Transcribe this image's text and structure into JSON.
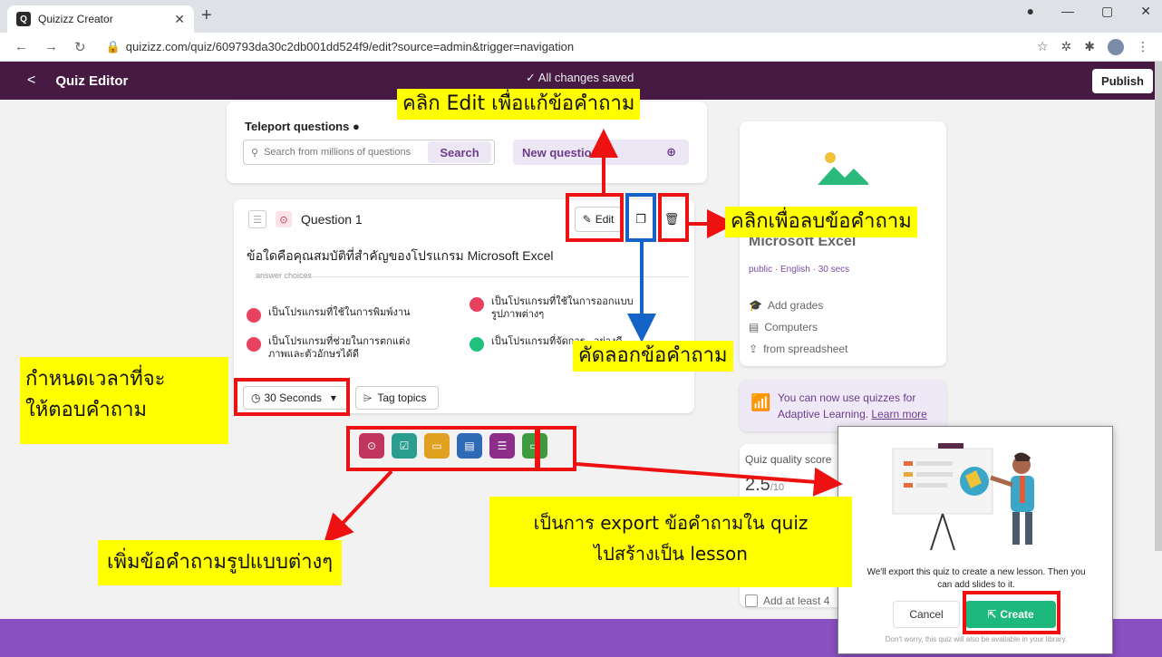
{
  "browser": {
    "tab_title": "Quizizz Creator",
    "tab_favicon": "Q",
    "url": "quizizz.com/quiz/609793da30c2db001dd524f9/edit?source=admin&trigger=navigation"
  },
  "app": {
    "back_icon": "<",
    "title": "Quiz Editor",
    "saved_status": "✓ All changes saved",
    "publish_label": "Publish"
  },
  "teleport": {
    "heading": "Teleport questions",
    "search_placeholder": "Search from millions of questions",
    "search_label": "Search",
    "new_question_label": "New question"
  },
  "question": {
    "label": "Question 1",
    "edit_label": "Edit",
    "text": "ข้อใดคือคุณสมบัติที่สำคัญของโปรแกรม Microsoft Excel",
    "answer_choices_label": "answer choices",
    "choices": [
      {
        "text": "เป็นโปรแกรมที่ใช้ในการพิมพ์งาน",
        "color": "#e8415f"
      },
      {
        "text": "เป็นโปรแกรมที่ใช้ในการออกแบบรูปภาพต่างๆ",
        "color": "#e8415f"
      },
      {
        "text": "เป็นโปรแกรมที่ช่วยในการตกแต่งภาพและตัวอักษรได้ดี",
        "color": "#e8415f"
      },
      {
        "text": "เป็นโปรแกรมที่จัดการ...อย่างดี",
        "color": "#1fc27d"
      }
    ],
    "time_label": "30 Seconds",
    "tag_label": "Tag topics"
  },
  "question_types": [
    {
      "name": "multiple-choice",
      "color": "#c0365c",
      "glyph": "⊙"
    },
    {
      "name": "checkbox",
      "color": "#2a9d8f",
      "glyph": "☑"
    },
    {
      "name": "fill-blank",
      "color": "#e0a020",
      "glyph": "▭"
    },
    {
      "name": "poll",
      "color": "#2f6ab7",
      "glyph": "▤"
    },
    {
      "name": "open-ended",
      "color": "#8c2d8a",
      "glyph": "☰"
    },
    {
      "name": "slide",
      "color": "#3d9a3f",
      "glyph": "▭"
    }
  ],
  "right_panel": {
    "quiz_name": "Microsoft Excel",
    "meta": "public · English · 30 secs",
    "add_grades": "Add grades",
    "subject": "Computers",
    "import": "from spreadsheet",
    "adaptive_text": "You can now use quizzes for Adaptive Learning.",
    "adaptive_link": "Learn more",
    "quality_label": "Quiz quality score",
    "quality_score": "2.5",
    "quality_out_of": "/10",
    "add_at_least": "Add at least 4"
  },
  "dialog": {
    "message": "We'll export this quiz to create a new lesson. Then you can add slides to it.",
    "cancel_label": "Cancel",
    "create_label": "Create",
    "footnote": "Don't worry, this quiz will also be available in your library."
  },
  "annotations": {
    "edit_note": "คลิก Edit เพื่อแก้ข้อคำถาม",
    "delete_note": "คลิกเพื่อลบข้อคำถาม",
    "copy_note": "คัดลอกข้อคำถาม",
    "time_note_1": "กำหนดเวลาที่จะ",
    "time_note_2": "ให้ตอบคำถาม",
    "types_note": "เพิ่มข้อคำถามรูปแบบต่างๆ",
    "export_note_1": "เป็นการ export ข้อคำถามใน quiz",
    "export_note_2": "ไปสร้างเป็น lesson"
  },
  "colors": {
    "header": "#461a42",
    "accent": "#8a4fc0",
    "highlight": "#ffff00",
    "annotation_red": "#ee1111",
    "annotation_blue": "#1464c8",
    "create_green": "#1db97c"
  }
}
